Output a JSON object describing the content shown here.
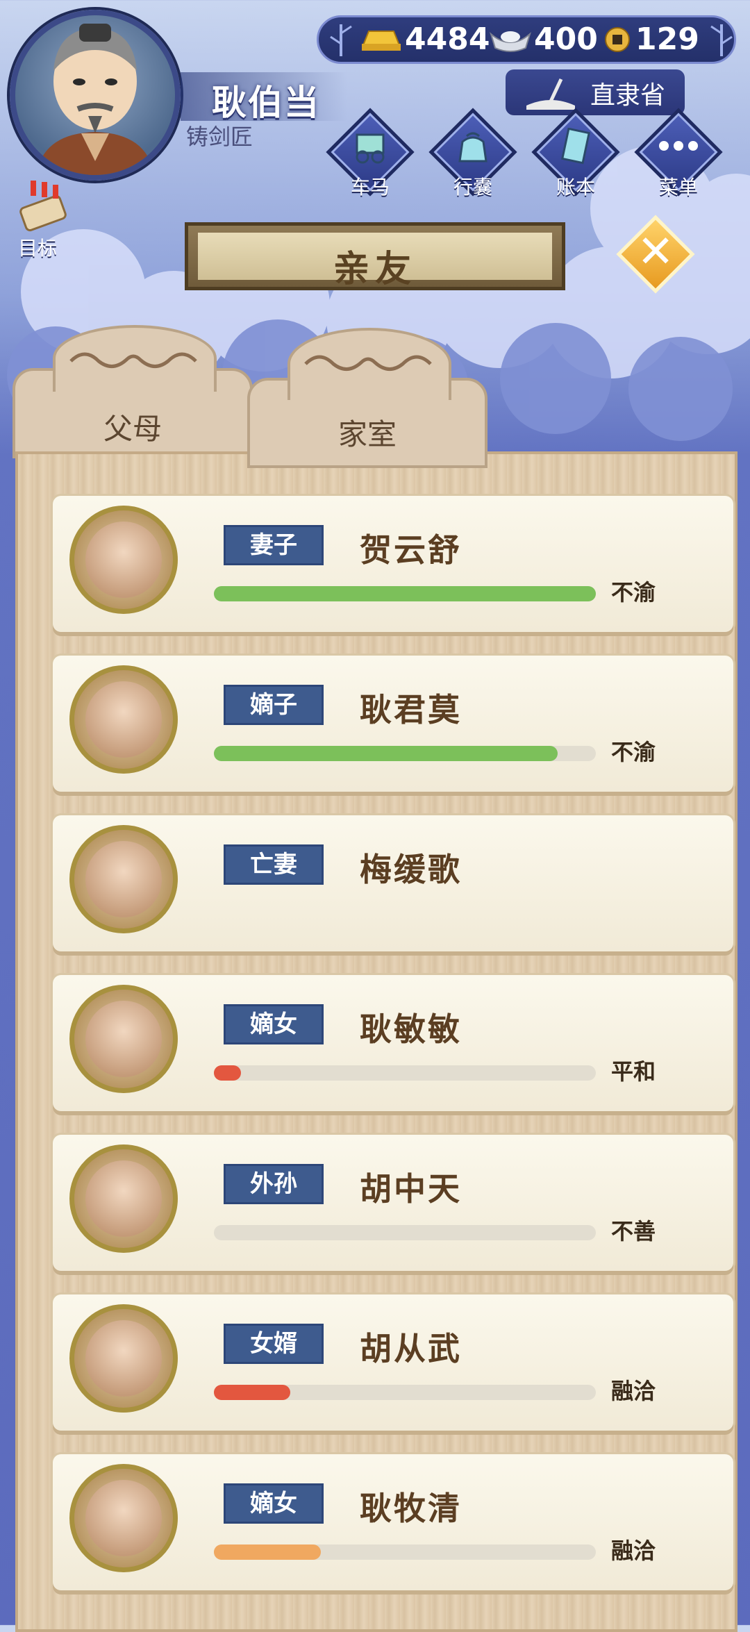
{
  "player": {
    "name": "耿伯当",
    "title": "铸剑匠"
  },
  "currency": {
    "gold": "4484",
    "silver": "400",
    "coin": "129"
  },
  "region": "直隶省",
  "nav": [
    {
      "label": "车马",
      "icon": "carriage-icon"
    },
    {
      "label": "行囊",
      "icon": "bag-icon"
    },
    {
      "label": "账本",
      "icon": "ledger-icon"
    },
    {
      "label": "菜单",
      "icon": "menu-icon"
    }
  ],
  "goal_label": "目标",
  "panel_title": "亲友",
  "tabs": [
    {
      "label": "父母"
    },
    {
      "label": "家室"
    }
  ],
  "members": [
    {
      "relation": "妻子",
      "name": "贺云舒",
      "mood": "不渝",
      "progress": 1.0,
      "bar_color": "#7cc05a"
    },
    {
      "relation": "嫡子",
      "name": "耿君莫",
      "mood": "不渝",
      "progress": 0.9,
      "bar_color": "#7cc05a"
    },
    {
      "relation": "亡妻",
      "name": "梅缓歌",
      "mood": "",
      "progress": null,
      "bar_color": ""
    },
    {
      "relation": "嫡女",
      "name": "耿敏敏",
      "mood": "平和",
      "progress": 0.07,
      "bar_color": "#e3573f"
    },
    {
      "relation": "外孙",
      "name": "胡中天",
      "mood": "不善",
      "progress": 0.0,
      "bar_color": "#e3573f"
    },
    {
      "relation": "女婿",
      "name": "胡从武",
      "mood": "融洽",
      "progress": 0.2,
      "bar_color": "#e3573f"
    },
    {
      "relation": "嫡女",
      "name": "耿牧清",
      "mood": "融洽",
      "progress": 0.28,
      "bar_color": "#f0a860"
    }
  ]
}
